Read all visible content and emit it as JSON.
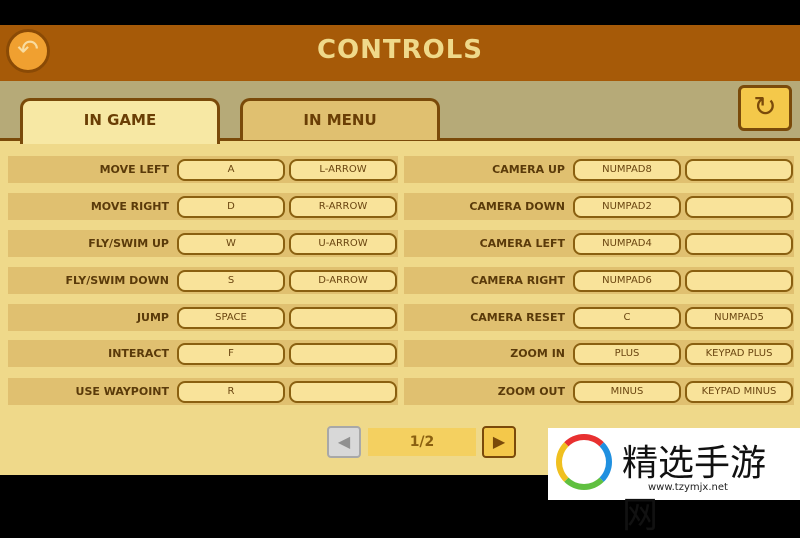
{
  "header": {
    "title": "CONTROLS",
    "back_icon": "back-arrow-icon"
  },
  "tabs": [
    {
      "label": "IN GAME",
      "active": true
    },
    {
      "label": "IN MENU",
      "active": false
    }
  ],
  "reset_icon": "refresh-icon",
  "left": [
    {
      "action": "MOVE LEFT",
      "key1": "A",
      "key2": "L-ARROW"
    },
    {
      "action": "MOVE RIGHT",
      "key1": "D",
      "key2": "R-ARROW"
    },
    {
      "action": "FLY/SWIM UP",
      "key1": "W",
      "key2": "U-ARROW"
    },
    {
      "action": "FLY/SWIM DOWN",
      "key1": "S",
      "key2": "D-ARROW"
    },
    {
      "action": "JUMP",
      "key1": "SPACE",
      "key2": ""
    },
    {
      "action": "INTERACT",
      "key1": "F",
      "key2": ""
    },
    {
      "action": "USE WAYPOINT",
      "key1": "R",
      "key2": ""
    }
  ],
  "right": [
    {
      "action": "CAMERA UP",
      "key1": "NUMPAD8",
      "key2": ""
    },
    {
      "action": "CAMERA DOWN",
      "key1": "NUMPAD2",
      "key2": ""
    },
    {
      "action": "CAMERA LEFT",
      "key1": "NUMPAD4",
      "key2": ""
    },
    {
      "action": "CAMERA RIGHT",
      "key1": "NUMPAD6",
      "key2": ""
    },
    {
      "action": "CAMERA RESET",
      "key1": "C",
      "key2": "NUMPAD5"
    },
    {
      "action": "ZOOM IN",
      "key1": "PLUS",
      "key2": "KEYPAD PLUS"
    },
    {
      "action": "ZOOM OUT",
      "key1": "MINUS",
      "key2": "KEYPAD MINUS"
    }
  ],
  "pagination": {
    "page": "1/2"
  },
  "watermark": {
    "text": "精选手游网",
    "url": "www.tzymjx.net"
  }
}
